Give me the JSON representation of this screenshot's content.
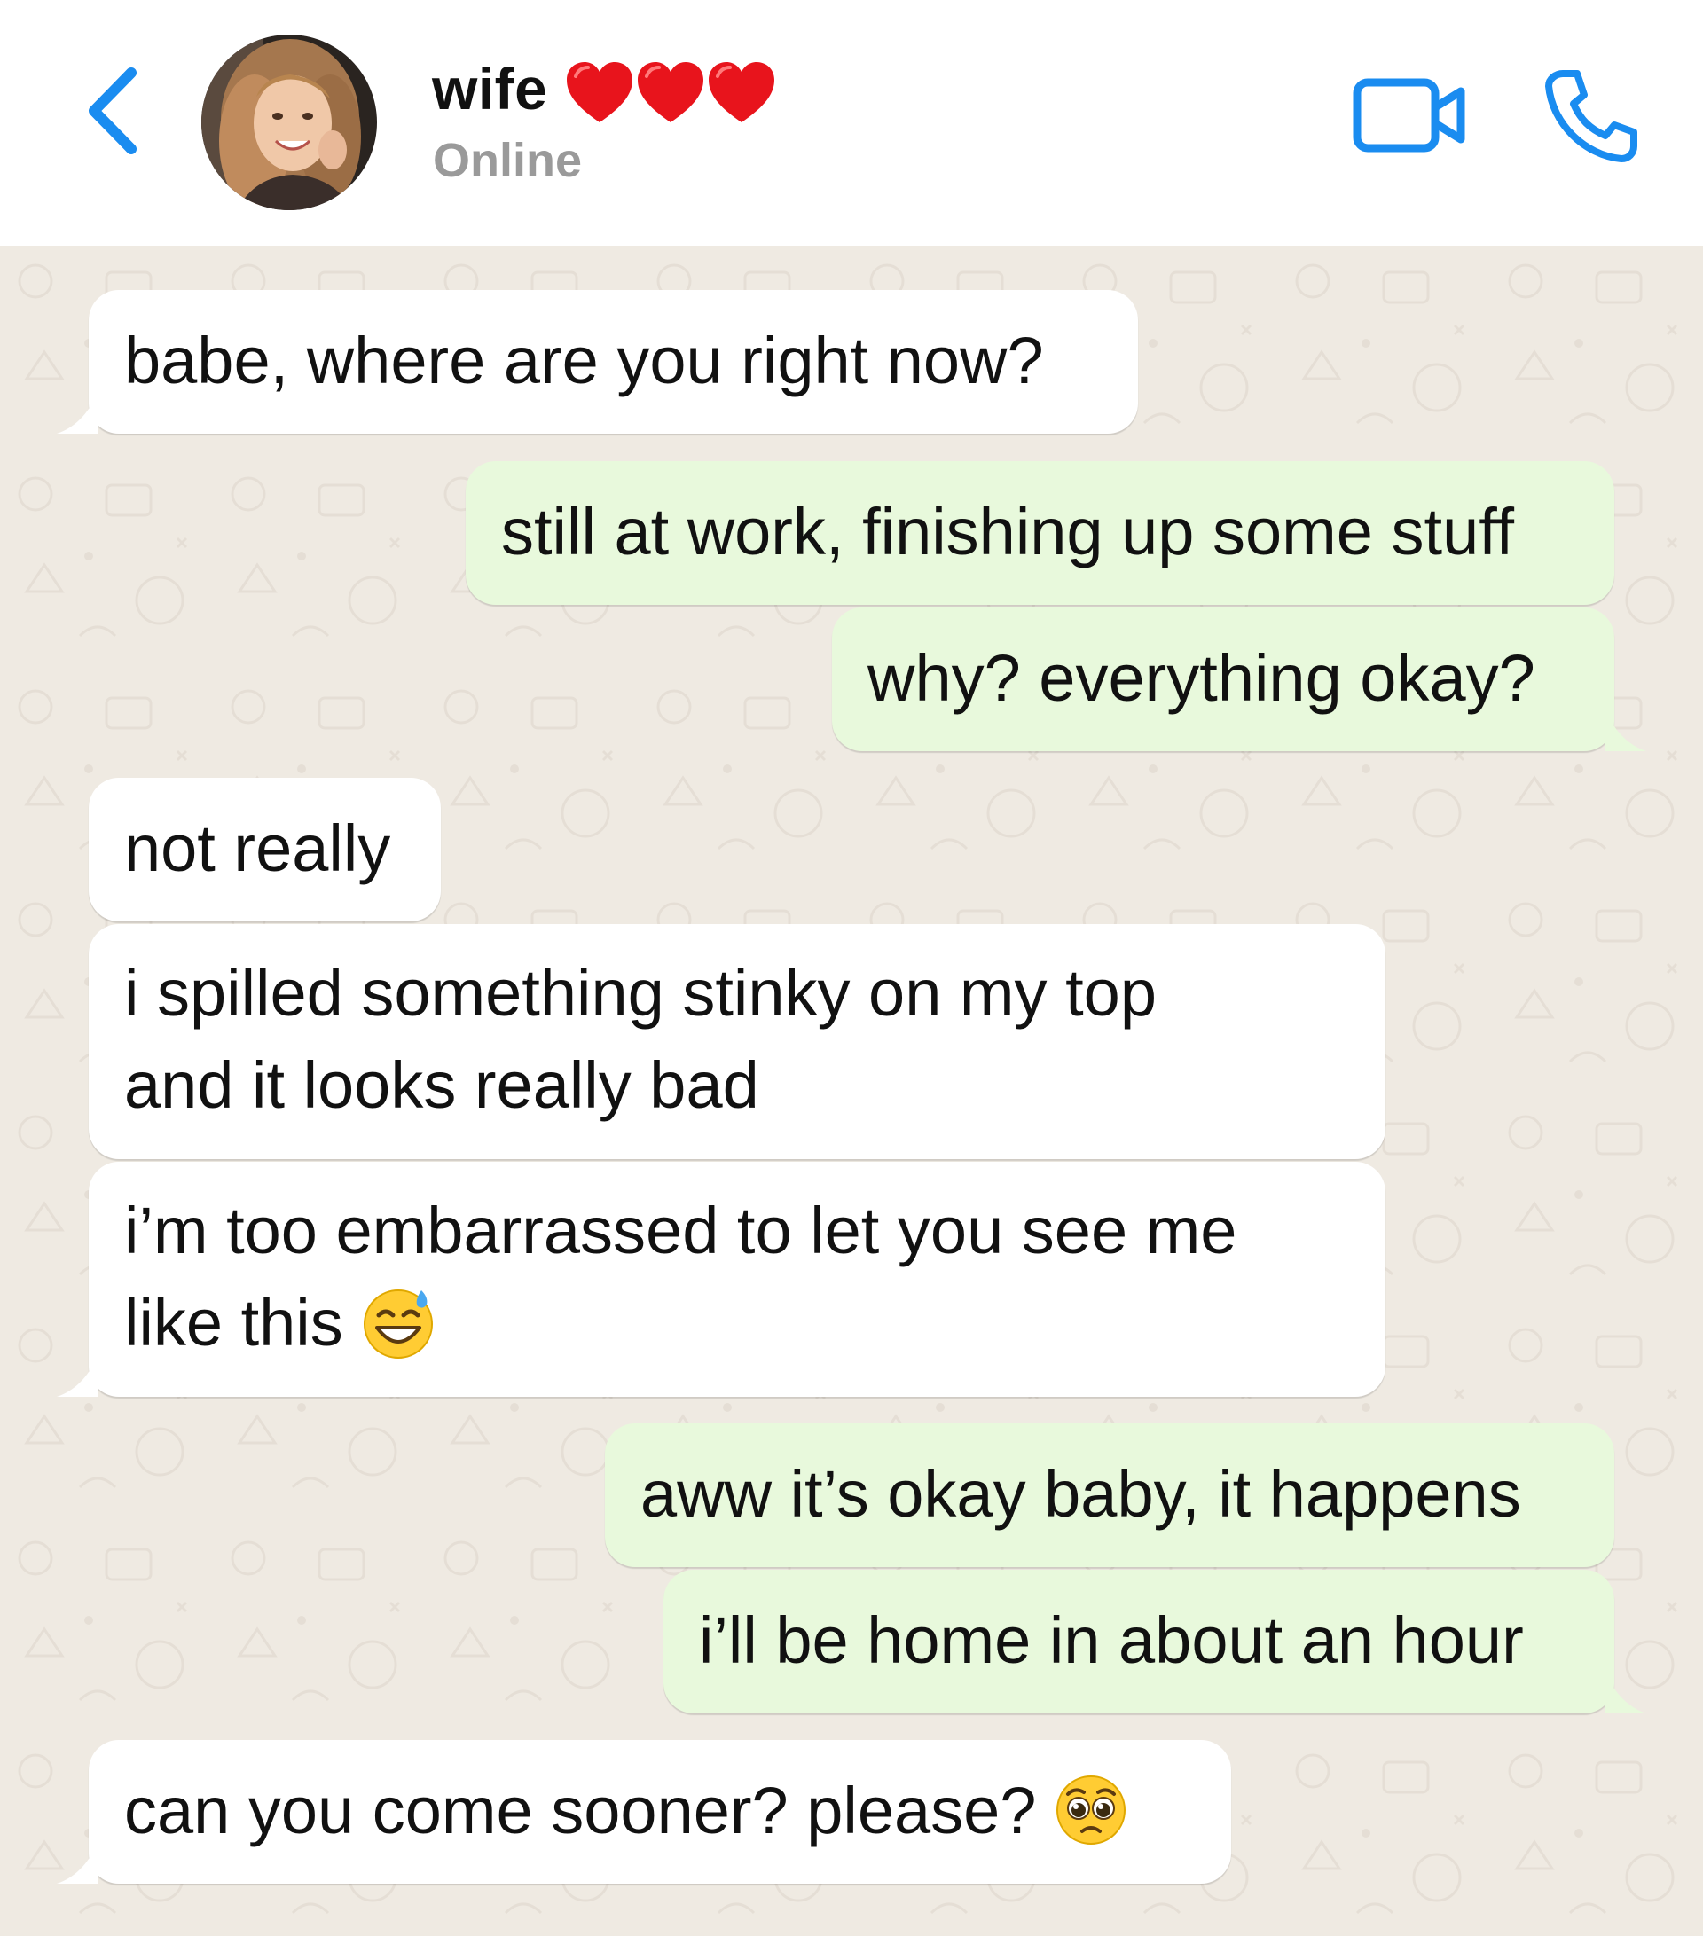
{
  "header": {
    "contact_name": "wife",
    "status": "Online",
    "back_icon": "chevron-left-icon",
    "video_icon": "video-camera-icon",
    "call_icon": "phone-icon",
    "accent_color": "#1a8cf0"
  },
  "messages": [
    {
      "direction": "incoming",
      "lines": [
        "babe, where are you right now?"
      ]
    },
    {
      "direction": "outgoing",
      "lines": [
        "still at work, finishing up some stuff"
      ]
    },
    {
      "direction": "outgoing",
      "lines": [
        "why? everything okay?"
      ]
    },
    {
      "direction": "incoming",
      "lines": [
        "not really"
      ]
    },
    {
      "direction": "incoming",
      "lines": [
        "i spilled something stinky on my top",
        "and it looks really bad"
      ]
    },
    {
      "direction": "incoming",
      "lines": [
        "i’m too embarrassed to let you see me",
        "like this"
      ],
      "emoji": "grinning-sweat-emoji"
    },
    {
      "direction": "outgoing",
      "lines": [
        "aww it’s okay baby, it happens"
      ]
    },
    {
      "direction": "outgoing",
      "lines": [
        "i’ll be home in about an hour"
      ]
    },
    {
      "direction": "incoming",
      "lines": [
        "can you come sooner? please?"
      ],
      "emoji": "pleading-face-emoji"
    }
  ],
  "colors": {
    "incoming_bubble": "#ffffff",
    "outgoing_bubble": "#e8f9dc",
    "chat_background": "#efeae2"
  }
}
